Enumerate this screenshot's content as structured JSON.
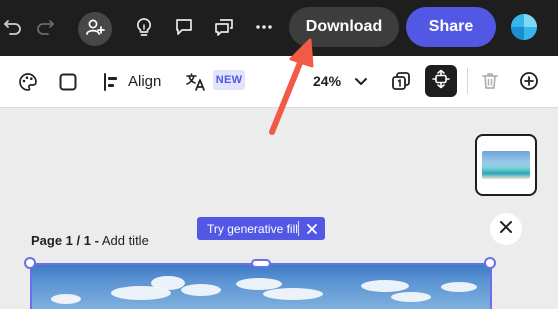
{
  "topbar": {
    "download_label": "Download",
    "share_label": "Share",
    "icons": [
      "undo-icon",
      "redo-icon",
      "add-person-icon",
      "lightbulb-icon",
      "comment-icon",
      "comments-icon",
      "more-icon"
    ]
  },
  "toolbar": {
    "align_label": "Align",
    "new_badge": "NEW",
    "zoom_value": "24%",
    "icons": [
      "palette-icon",
      "square-icon",
      "align-icon",
      "translate-icon",
      "chevron-down-icon",
      "layers-icon",
      "position-icon",
      "trash-icon",
      "add-icon"
    ]
  },
  "canvas": {
    "page_label_bold": "Page 1 / 1 -",
    "page_label_action": "Add title",
    "generative_fill_label": "Try generative fill"
  },
  "colors": {
    "topbar_bg": "#1e1e1e",
    "share_bg": "#5258e4",
    "download_bg": "#3d3d3d",
    "accent": "#5258e4",
    "arrow": "#f05a46"
  }
}
